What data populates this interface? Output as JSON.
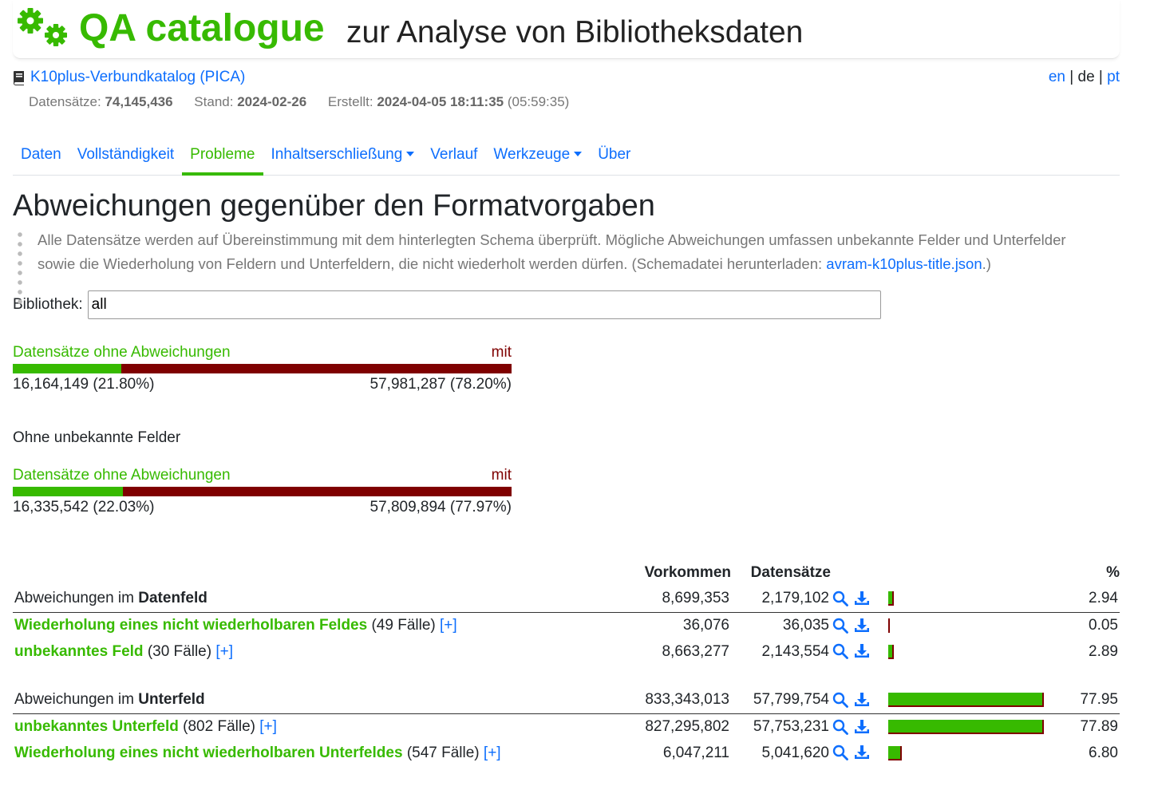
{
  "header": {
    "brand": "QA catalogue",
    "tagline": "zur Analyse von Bibliotheksdaten",
    "logo_icon": "gears-icon"
  },
  "catalog": {
    "name": "K10plus-Verbundkatalog (PICA)",
    "icon": "book-icon",
    "records_label": "Datensätze:",
    "records_value": "74,145,436",
    "state_label": "Stand:",
    "state_value": "2024-02-26",
    "created_label": "Erstellt:",
    "created_value": "2024-04-05 18:11:35",
    "created_duration": "(05:59:35)"
  },
  "languages": {
    "en": "en",
    "de": "de",
    "pt": "pt",
    "sep": "|",
    "active": "de"
  },
  "nav": {
    "tabs": [
      {
        "label": "Daten"
      },
      {
        "label": "Vollständigkeit"
      },
      {
        "label": "Probleme"
      },
      {
        "label": "Inhaltserschließung"
      },
      {
        "label": "Verlauf"
      },
      {
        "label": "Werkzeuge"
      },
      {
        "label": "Über"
      }
    ],
    "active": "Probleme"
  },
  "page": {
    "title": "Abweichungen gegenüber den Formatvorgaben",
    "description_pre": "Alle Datensätze werden auf Übereinstimmung mit dem hinterlegten Schema überprüft. Mögliche Abweichungen umfassen unbekannte Felder und Unterfelder sowie die Wiederholung von Feldern und Unterfeldern, die nicht wiederholt werden dürfen. (Schemadatei herunterladen: ",
    "description_link": "avram-k10plus-title.json",
    "description_post": ".)"
  },
  "filter": {
    "label": "Bibliothek:",
    "value": "all"
  },
  "summary_all": {
    "ok_label": "Datensätze ohne Abweichungen",
    "bad_label": "mit",
    "ok_value": "16,164,149 (21.80%)",
    "bad_value": "57,981,287 (78.20%)",
    "ok_fraction": 0.218
  },
  "summary_known_heading": "Ohne unbekannte Felder",
  "summary_known": {
    "ok_label": "Datensätze ohne Abweichungen",
    "bad_label": "mit",
    "ok_value": "16,335,542 (22.03%)",
    "bad_value": "57,809,894 (77.97%)",
    "ok_fraction": 0.2203
  },
  "colors": {
    "accent_green": "#37ba00",
    "error_red": "#7f0000",
    "link_blue": "#0d6efd"
  },
  "table": {
    "headers": {
      "occurrences": "Vorkommen",
      "records": "Datensätze",
      "percent": "%"
    },
    "rows": [
      {
        "kind": "category",
        "prefix": "Abweichungen im",
        "bold": "Datenfeld",
        "occurrences": "8,699,353",
        "records": "2,179,102",
        "percent": "2.94",
        "pct_value": 2.94
      },
      {
        "kind": "type",
        "name": "Wiederholung eines nicht wiederholbaren Feldes",
        "cases": "(49 Fälle)",
        "expand": "[+]",
        "occurrences": "36,076",
        "records": "36,035",
        "percent": "0.05",
        "pct_value": 0.05
      },
      {
        "kind": "type",
        "name": "unbekanntes Feld",
        "cases": "(30 Fälle)",
        "expand": "[+]",
        "occurrences": "8,663,277",
        "records": "2,143,554",
        "percent": "2.89",
        "pct_value": 2.89
      },
      {
        "kind": "spacer"
      },
      {
        "kind": "category",
        "prefix": "Abweichungen im",
        "bold": "Unterfeld",
        "occurrences": "833,343,013",
        "records": "57,799,754",
        "percent": "77.95",
        "pct_value": 77.95
      },
      {
        "kind": "type",
        "name": "unbekanntes Unterfeld",
        "cases": "(802 Fälle)",
        "expand": "[+]",
        "occurrences": "827,295,802",
        "records": "57,753,231",
        "percent": "77.89",
        "pct_value": 77.89
      },
      {
        "kind": "type",
        "name": "Wiederholung eines nicht wiederholbaren Unterfeldes",
        "cases": "(547 Fälle)",
        "expand": "[+]",
        "occurrences": "6,047,211",
        "records": "5,041,620",
        "percent": "6.80",
        "pct_value": 6.8
      }
    ],
    "row_icons": [
      "search-icon",
      "download-icon"
    ]
  }
}
